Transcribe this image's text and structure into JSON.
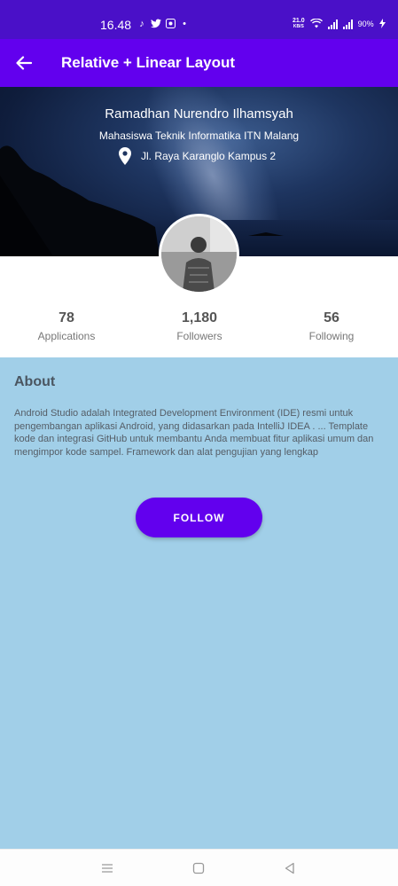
{
  "status_bar": {
    "time": "16.48",
    "net_speed_value": "21.0",
    "net_speed_unit": "KB/S",
    "battery": "90%",
    "icons": [
      "tiktok-icon",
      "twitter-icon",
      "gallery-icon",
      "dot-icon",
      "wifi-icon",
      "signal-icon",
      "signal-icon",
      "charging-icon"
    ]
  },
  "app_bar": {
    "title": "Relative + Linear Layout",
    "back_icon": "arrow-back-icon"
  },
  "profile": {
    "name": "Ramadhan Nurendro Ilhamsyah",
    "subtitle": "Mahasiswa Teknik Informatika ITN Malang",
    "location": "Jl. Raya Karanglo Kampus 2",
    "location_icon": "map-pin-icon"
  },
  "stats": [
    {
      "value": "78",
      "label": "Applications"
    },
    {
      "value": "1,180",
      "label": "Followers"
    },
    {
      "value": "56",
      "label": "Following"
    }
  ],
  "about": {
    "title": "About",
    "text": "Android Studio adalah Integrated Development Environment (IDE) resmi untuk pengembangan aplikasi Android, yang didasarkan pada IntelliJ IDEA . ... Template kode dan integrasi GitHub untuk membantu Anda membuat fitur aplikasi umum dan mengimpor kode sampel. Framework dan alat pengujian yang lengkap"
  },
  "follow_button": {
    "label": "FOLLOW"
  },
  "colors": {
    "status_bar": "#4a10c8",
    "app_bar": "#6200ee",
    "content_bg": "#a1cfe8",
    "button": "#6200ee"
  },
  "nav_bar": {
    "icons": [
      "menu-icon",
      "home-square-icon",
      "back-triangle-icon"
    ]
  }
}
